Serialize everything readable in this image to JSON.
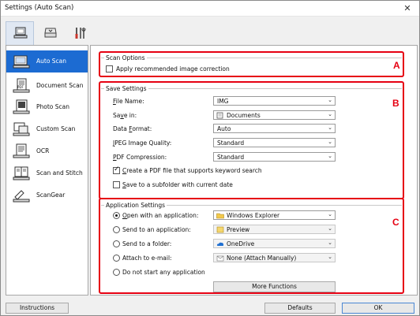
{
  "window": {
    "title": "Settings (Auto Scan)",
    "close": "✕"
  },
  "toolbar": {
    "tabs": [
      "scan-from-computer",
      "scan-from-operation-panel",
      "general-settings"
    ]
  },
  "sidebar": {
    "items": [
      {
        "label": "Auto Scan",
        "icon": "auto-scan-icon",
        "active": true
      },
      {
        "label": "Document Scan",
        "icon": "document-scan-icon"
      },
      {
        "label": "Photo Scan",
        "icon": "photo-scan-icon"
      },
      {
        "label": "Custom Scan",
        "icon": "custom-scan-icon"
      },
      {
        "label": "OCR",
        "icon": "ocr-icon"
      },
      {
        "label": "Scan and Stitch",
        "icon": "scan-and-stitch-icon"
      },
      {
        "label": "ScanGear",
        "icon": "scangear-icon"
      }
    ]
  },
  "scan_options": {
    "title": "Scan Options",
    "marker": "A",
    "apply_correction": {
      "label": "Apply recommended image correction",
      "checked": false
    }
  },
  "save_settings": {
    "title": "Save Settings",
    "marker": "B",
    "file_name": {
      "label_pre": "",
      "label_u": "F",
      "label_post": "ile Name:",
      "value": "IMG"
    },
    "save_in": {
      "label_pre": "Sa",
      "label_u": "v",
      "label_post": "e in:",
      "value": "Documents"
    },
    "data_format": {
      "label_pre": "Data ",
      "label_u": "F",
      "label_post": "ormat:",
      "value": "Auto"
    },
    "jpeg_quality": {
      "label_pre": "",
      "label_u": "J",
      "label_post": "PEG Image Quality:",
      "value": "Standard"
    },
    "pdf_compression": {
      "label_pre": "",
      "label_u": "P",
      "label_post": "DF Compression:",
      "value": "Standard"
    },
    "create_pdf": {
      "label_pre": "",
      "label_u": "C",
      "label_post": "reate a PDF file that supports keyword search",
      "checked": true
    },
    "save_subfolder": {
      "label_pre": "",
      "label_u": "S",
      "label_post": "ave to a subfolder with current date",
      "checked": false
    }
  },
  "app_settings": {
    "title": "Application Settings",
    "marker": "C",
    "open_app": {
      "label_pre": "",
      "label_u": "O",
      "label_post": "pen with an application:",
      "value": "Windows Explorer",
      "selected": true
    },
    "send_app": {
      "label_pre": "Send to an application:",
      "value": "Preview",
      "selected": false
    },
    "send_folder": {
      "label_pre": "Send to a folder:",
      "value": "OneDrive",
      "selected": false
    },
    "attach_email": {
      "label_pre": "Attach to e-mail:",
      "value": "None (Attach Manually)",
      "selected": false
    },
    "no_app": {
      "label": "Do not start any application",
      "selected": false
    },
    "more_functions": "More Functions"
  },
  "footer": {
    "instructions": "Instructions",
    "defaults": "Defaults",
    "ok": "OK"
  }
}
